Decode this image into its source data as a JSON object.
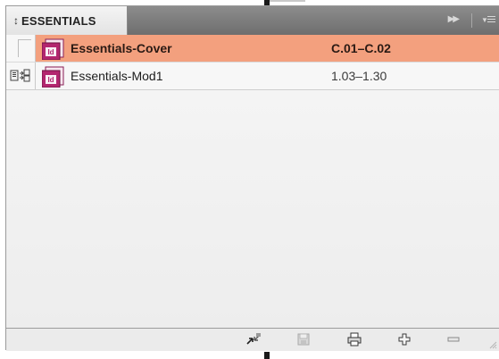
{
  "panel": {
    "tab_label": "ESSENTIALS",
    "tab_arrows": "↕"
  },
  "header_icons": [
    "collapse-arrows-icon",
    "panel-menu-icon"
  ],
  "documents": [
    {
      "name": "Essentials-Cover",
      "pages": "C.01–C.02",
      "selected": true,
      "sync_icon": ""
    },
    {
      "name": "Essentials-Mod1",
      "pages": "1.03–1.30",
      "selected": false,
      "sync_icon": "style-source-icon"
    }
  ],
  "toolbar": {
    "buttons": [
      "synchronize-icon",
      "save-book-icon",
      "print-book-icon",
      "add-document-icon",
      "remove-document-icon"
    ]
  },
  "colors": {
    "selected_row": "#f3a07e",
    "indesign_icon": "#b3266f",
    "header_bg": "#7a7a7a"
  }
}
